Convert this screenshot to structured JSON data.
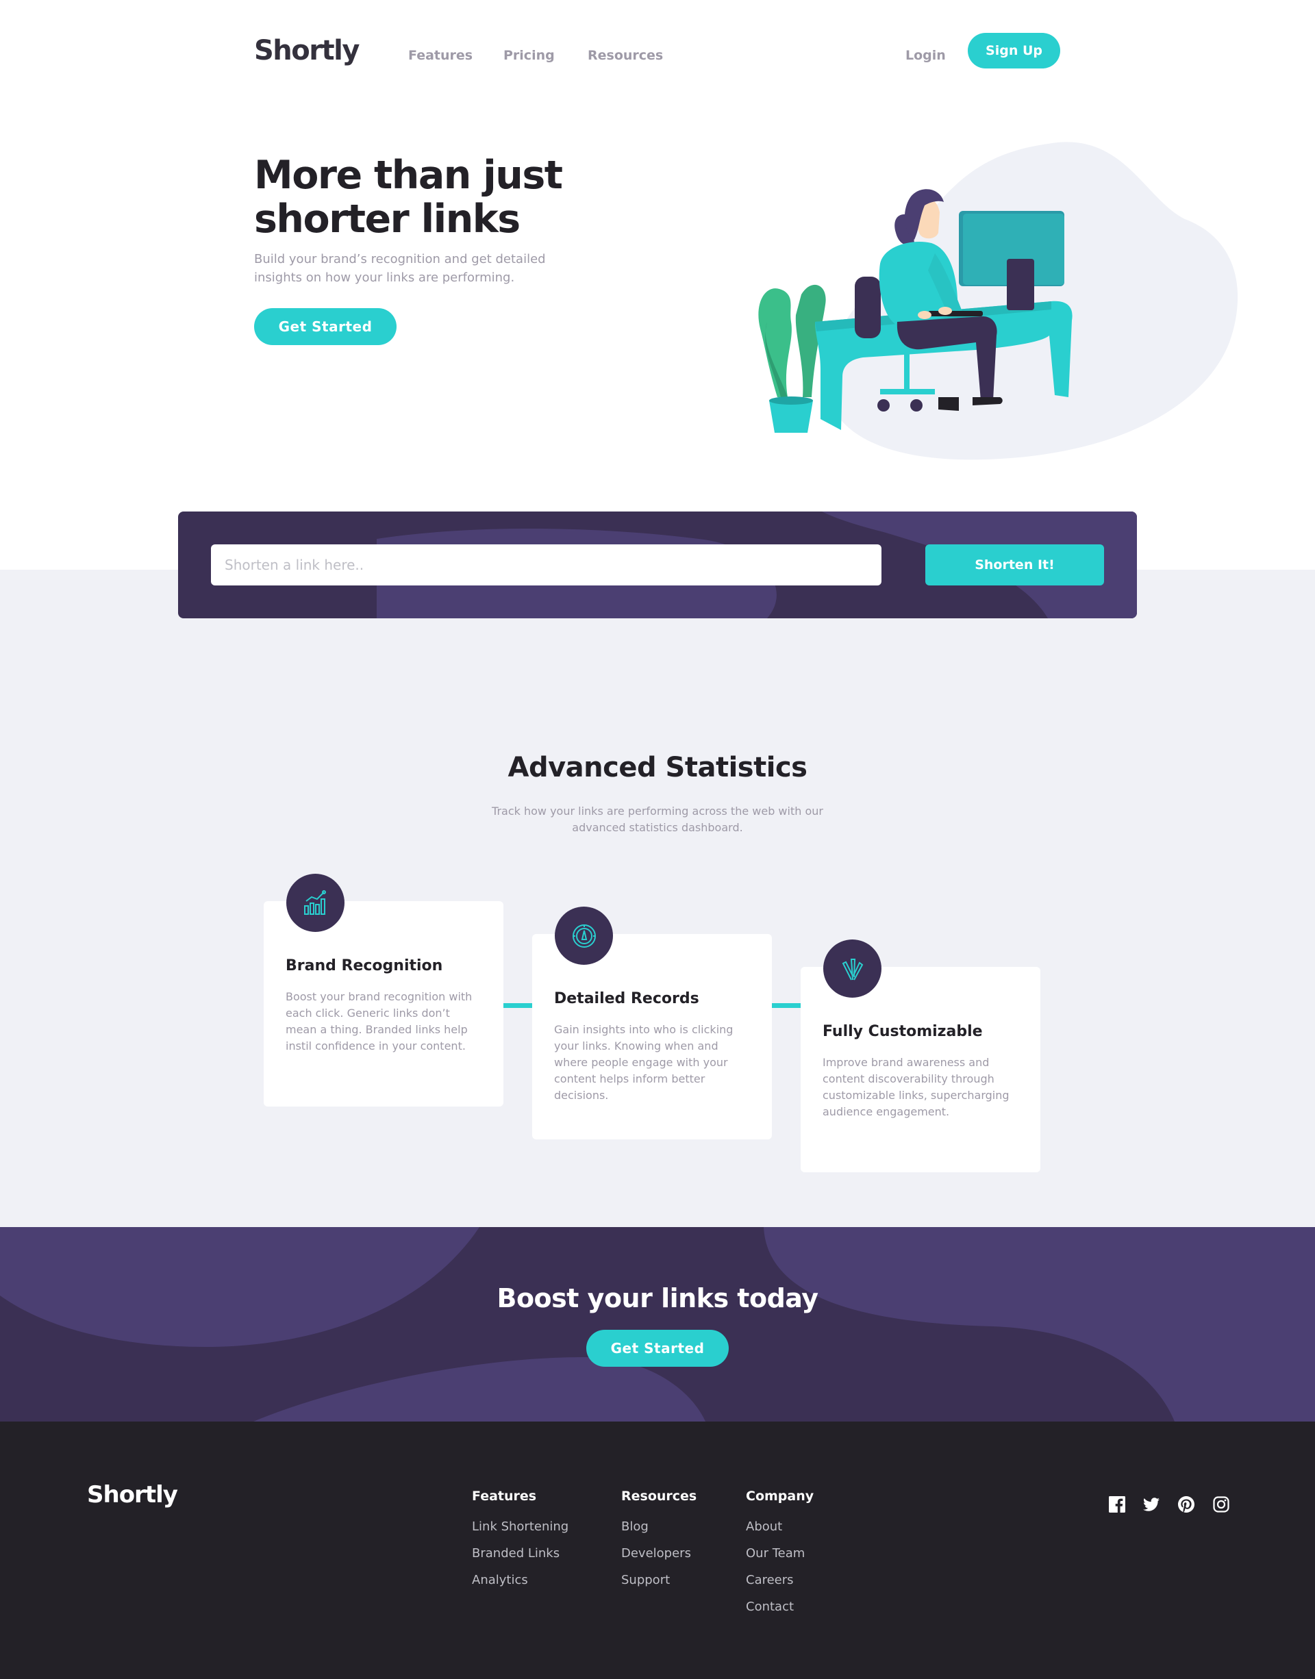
{
  "brand": {
    "name": "Shortly"
  },
  "nav": {
    "items": [
      {
        "label": "Features"
      },
      {
        "label": "Pricing"
      },
      {
        "label": "Resources"
      }
    ],
    "login_label": "Login",
    "signup_label": "Sign Up"
  },
  "hero": {
    "title": "More than just shorter links",
    "subtitle": "Build your brand’s recognition and get detailed insights on how your links are performing.",
    "cta_label": "Get Started"
  },
  "shorten": {
    "input_placeholder": "Shorten a link here..",
    "button_label": "Shorten It!"
  },
  "statistics": {
    "title": "Advanced Statistics",
    "subtitle": "Track how your links are performing across the web with our advanced statistics dashboard.",
    "cards": [
      {
        "title": "Brand Recognition",
        "text": "Boost your brand recognition with each click. Generic links don’t mean a thing. Branded links help instil confidence in your content.",
        "icon": "chart-bars-icon"
      },
      {
        "title": "Detailed Records",
        "text": "Gain insights into who is clicking your links. Knowing when and where people engage with your content helps inform better decisions.",
        "icon": "gauge-icon"
      },
      {
        "title": "Fully Customizable",
        "text": "Improve brand awareness and content discoverability through customizable links, supercharging audience engagement.",
        "icon": "brush-tools-icon"
      }
    ]
  },
  "boost": {
    "title": "Boost your links today",
    "cta_label": "Get Started"
  },
  "footer": {
    "logo": "Shortly",
    "columns": [
      {
        "heading": "Features",
        "links": [
          "Link Shortening",
          "Branded Links",
          "Analytics"
        ]
      },
      {
        "heading": "Resources",
        "links": [
          "Blog",
          "Developers",
          "Support"
        ]
      },
      {
        "heading": "Company",
        "links": [
          "About",
          "Our Team",
          "Careers",
          "Contact"
        ]
      }
    ],
    "social": [
      "facebook-icon",
      "twitter-icon",
      "pinterest-icon",
      "instagram-icon"
    ]
  },
  "colors": {
    "accent": "#2acfcf",
    "dark_violet": "#3b3054",
    "very_dark": "#232127",
    "gray": "#9e9aa7",
    "light_bg": "#f0f1f6"
  }
}
